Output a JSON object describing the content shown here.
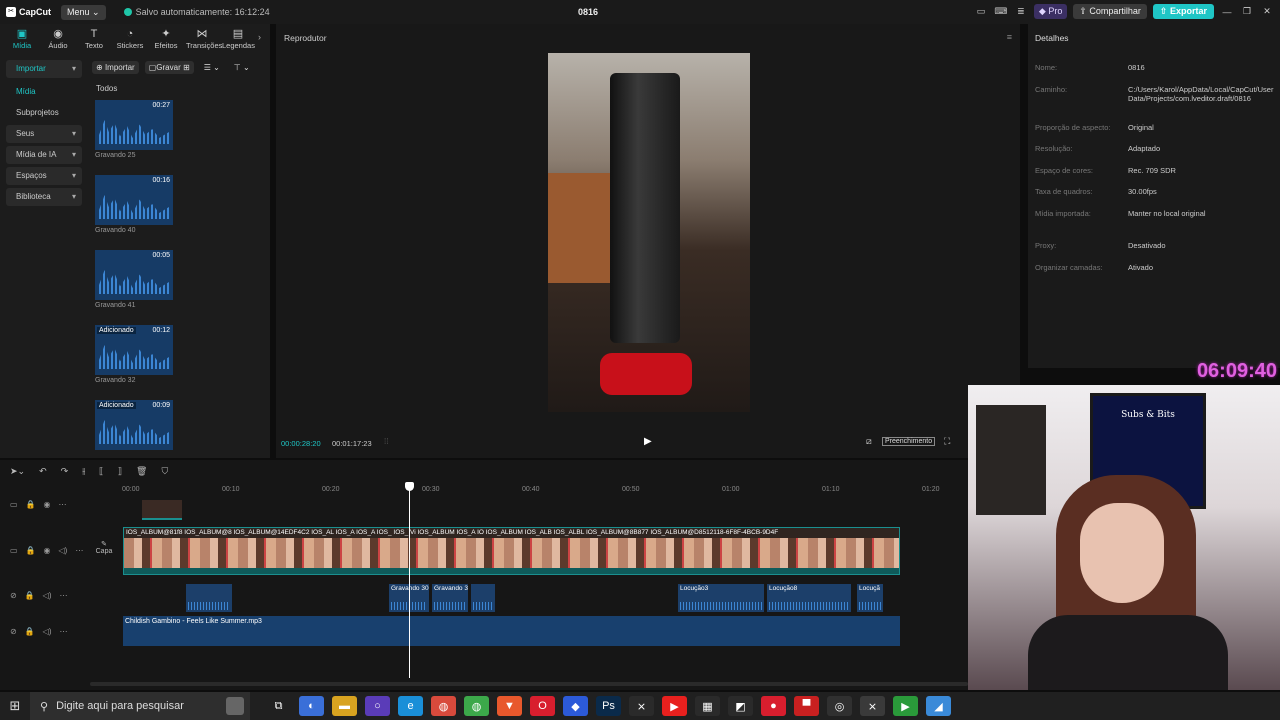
{
  "titlebar": {
    "logo": "CapCut",
    "menu": "Menu",
    "autosave": "Salvo automaticamente: 16:12:24",
    "project": "0816",
    "pro": "Pro",
    "share": "Compartilhar",
    "export": "Exportar"
  },
  "toptabs": [
    {
      "label": "Mídia",
      "icon": "media-icon",
      "glyph": "▣"
    },
    {
      "label": "Áudio",
      "icon": "audio-icon",
      "glyph": "◉"
    },
    {
      "label": "Texto",
      "icon": "text-icon",
      "glyph": "T"
    },
    {
      "label": "Stickers",
      "icon": "sticker-icon",
      "glyph": "◔"
    },
    {
      "label": "Efeitos",
      "icon": "effects-icon",
      "glyph": "✦"
    },
    {
      "label": "Transições",
      "icon": "transitions-icon",
      "glyph": "⋈"
    },
    {
      "label": "Legendas",
      "icon": "captions-icon",
      "glyph": "▤"
    }
  ],
  "sidebar": {
    "items": [
      {
        "label": "Importar",
        "style": "hl",
        "caret": "▾"
      },
      {
        "label": "Mídia",
        "style": "act",
        "caret": ""
      },
      {
        "label": "Subprojetos",
        "style": "",
        "caret": ""
      },
      {
        "label": "Seus",
        "style": "grp",
        "caret": "▾"
      },
      {
        "label": "Mídia de IA",
        "style": "grp",
        "caret": "▾"
      },
      {
        "label": "Espaços",
        "style": "grp",
        "caret": "▾"
      },
      {
        "label": "Biblioteca",
        "style": "grp",
        "caret": "▾"
      }
    ]
  },
  "media": {
    "import_btn": "Importar",
    "record_btn": "Gravar",
    "all_label": "Todos",
    "items": [
      {
        "duration": "00:27",
        "name": "Gravando 25",
        "tag": ""
      },
      {
        "duration": "00:16",
        "name": "Gravando 40",
        "tag": ""
      },
      {
        "duration": "00:05",
        "name": "Gravando 41",
        "tag": ""
      },
      {
        "duration": "00:12",
        "name": "Gravando 32",
        "tag": "Adicionado"
      },
      {
        "duration": "00:09",
        "name": "",
        "tag": "Adicionado"
      }
    ]
  },
  "player": {
    "title": "Reprodutor",
    "current_time": "00:00:28:20",
    "total_time": "00:01:17:23",
    "fill_label": "Preenchimento"
  },
  "details": {
    "title": "Detalhes",
    "rows": [
      {
        "label": "Nome:",
        "value": "0816"
      },
      {
        "label": "Caminho:",
        "value": "C:/Users/Karol/AppData/Local/CapCut/User Data/Projects/com.lveditor.draft/0816"
      },
      {
        "label": "Proporção de aspecto:",
        "value": "Original"
      },
      {
        "label": "Resolução:",
        "value": "Adaptado"
      },
      {
        "label": "Espaço de cores:",
        "value": "Rec. 709 SDR"
      },
      {
        "label": "Taxa de quadros:",
        "value": "30.00fps"
      },
      {
        "label": "Mídia importada:",
        "value": "Manter no local original"
      },
      {
        "label": "Proxy:",
        "value": "Desativado"
      },
      {
        "label": "Organizar camadas:",
        "value": "Ativado"
      }
    ]
  },
  "timeline": {
    "ticks": [
      "00:00",
      "00:10",
      "00:20",
      "00:30",
      "00:40",
      "00:50",
      "01:00",
      "01:10",
      "01:20"
    ],
    "capa_label": "Capa",
    "video_clip_label": "IOS_ALBUM@81f8   IOS_ALBUM@8   IOS_ALBUM@14EDF4C2   IOS_AL   IOS_A   IOS_A   IOS_   IOS_   Vi   IOS_ALBUM   IOS_A   IO   IOS_ALBUM   IOS_ALB   IOS_ALBL   IOS_ALBUM@8B877   IOS_ALBUM@D8512118-6F8F-4BCB-9D4F",
    "audio_clips": [
      {
        "name": ""
      },
      {
        "name": "Gravando 30"
      },
      {
        "name": "Gravando 3"
      },
      {
        "name": ""
      },
      {
        "name": "Locução3"
      },
      {
        "name": "Locução8"
      },
      {
        "name": "Locuçã"
      }
    ],
    "music_name": "Childish Gambino - Feels Like Summer.mp3"
  },
  "overlay": {
    "clock": "06:09:40",
    "board_text": "Subs & Bits"
  },
  "taskbar": {
    "search_placeholder": "Digite aqui para pesquisar",
    "apps": [
      {
        "icon": "task-view-icon",
        "glyph": "⧉",
        "color": "#202020"
      },
      {
        "icon": "copilot-icon",
        "glyph": "◐",
        "color": "#3a6fd8"
      },
      {
        "icon": "file-explorer-icon",
        "glyph": "▬",
        "color": "#d8a320"
      },
      {
        "icon": "app-purple-icon",
        "glyph": "○",
        "color": "#5a3cb8"
      },
      {
        "icon": "edge-icon",
        "glyph": "e",
        "color": "#1a8fd8"
      },
      {
        "icon": "chrome-icon",
        "glyph": "◍",
        "color": "#d84a3c"
      },
      {
        "icon": "chrome-alt-icon",
        "glyph": "◍",
        "color": "#3ca84a"
      },
      {
        "icon": "brave-icon",
        "glyph": "▼",
        "color": "#e8582c"
      },
      {
        "icon": "opera-icon",
        "glyph": "O",
        "color": "#d81e2e"
      },
      {
        "icon": "app-diamond-icon",
        "glyph": "◆",
        "color": "#2c5ad8"
      },
      {
        "icon": "photoshop-icon",
        "glyph": "Ps",
        "color": "#0a2a4a"
      },
      {
        "icon": "capcut-icon",
        "glyph": "⨯",
        "color": "#2a2a2a"
      },
      {
        "icon": "youtube-icon",
        "glyph": "▶",
        "color": "#e8201e"
      },
      {
        "icon": "store-icon",
        "glyph": "▦",
        "color": "#2a2a2a"
      },
      {
        "icon": "app-dark-icon",
        "glyph": "◩",
        "color": "#2a2a2a"
      },
      {
        "icon": "app-red-icon",
        "glyph": "●",
        "color": "#d81e2e"
      },
      {
        "icon": "app-banner-icon",
        "glyph": "▀",
        "color": "#c82020"
      },
      {
        "icon": "obs-icon",
        "glyph": "◎",
        "color": "#303030"
      },
      {
        "icon": "capcut-active-icon",
        "glyph": "⨯",
        "color": "#3a3a3a"
      },
      {
        "icon": "app-green-icon",
        "glyph": "▶",
        "color": "#2a9a3a"
      },
      {
        "icon": "app-blue-icon",
        "glyph": "◢",
        "color": "#3a8ad8"
      }
    ]
  }
}
